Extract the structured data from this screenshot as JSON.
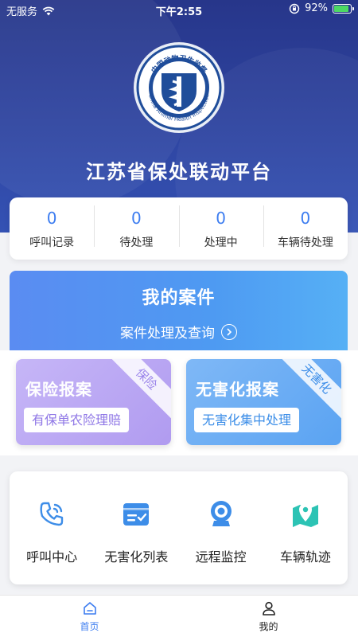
{
  "status_bar": {
    "carrier": "无服务",
    "time": "下午2:55",
    "battery": "92%",
    "battery_level": 0.92
  },
  "header": {
    "emblem_text_cn": "中国动物卫生监督",
    "emblem_text_en": "China Animal Health Inspection",
    "title": "江苏省保处联动平台"
  },
  "stats": [
    {
      "value": "0",
      "label": "呼叫记录"
    },
    {
      "value": "0",
      "label": "待处理"
    },
    {
      "value": "0",
      "label": "处理中"
    },
    {
      "value": "0",
      "label": "车辆待处理"
    }
  ],
  "case_banner": {
    "title": "我的案件",
    "link": "案件处理及查询"
  },
  "cards": {
    "insure": {
      "title": "保险报案",
      "pill": "有保单农险理赔",
      "ribbon": "保险"
    },
    "harmless": {
      "title": "无害化报案",
      "pill": "无害化集中处理",
      "ribbon": "无害化"
    }
  },
  "functions": [
    {
      "label": "呼叫中心",
      "icon": "phone-call-icon"
    },
    {
      "label": "无害化列表",
      "icon": "list-check-icon"
    },
    {
      "label": "远程监控",
      "icon": "webcam-icon"
    },
    {
      "label": "车辆轨迹",
      "icon": "map-pin-icon"
    }
  ],
  "tabbar": {
    "home": "首页",
    "mine": "我的"
  },
  "colors": {
    "header": "#2f46a3",
    "accent": "#3d7df0",
    "insure_card": "#b09bf0",
    "harmless_card": "#5aa3f2",
    "function_icon": "#3d8de8"
  }
}
